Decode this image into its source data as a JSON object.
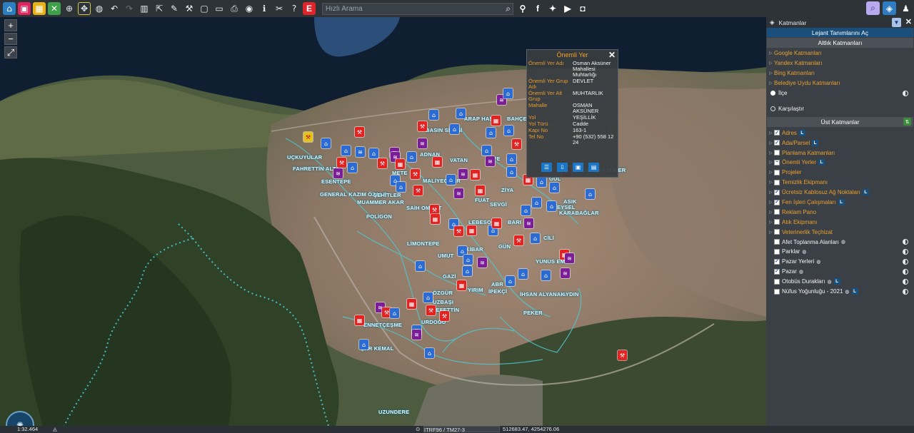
{
  "toolbar": {
    "search_placeholder": "Hızlı Arama",
    "icons": [
      "home-icon",
      "save-icon",
      "grid-icon",
      "expand-icon",
      "zoom-in-icon",
      "move-icon",
      "globe-icon",
      "undo-icon",
      "redo-icon",
      "trash-icon",
      "share-icon",
      "pencil-icon",
      "tools-icon",
      "frame-icon",
      "comment-icon",
      "print-icon",
      "info-pin-icon",
      "info-icon",
      "measure-icon",
      "help-icon",
      "e-logo-icon"
    ]
  },
  "map": {
    "zoom_in": "+",
    "zoom_out": "−",
    "fullscreen": "⤢",
    "labels": [
      "UÇKUYULAR",
      "FAHRETTİN ALTAY",
      "ESENTEPE",
      "GENERAL KAZIM ÖZALP",
      "MUAMMER AKAR",
      "POLİGON",
      "ŞEHİTLER",
      "MALİYECİLER",
      "SAİH OMURT",
      "BASIN SİTESİ",
      "ARAP HASAN",
      "BAHÇE",
      "ADNAN",
      "VATAN",
      "OSMAN AKSÜNER",
      "KARABAĞLAR",
      "ASIK",
      "EYSEL",
      "ZİYA",
      "SEVGİ",
      "REFE",
      "LİMONTEPE",
      "KİBAR",
      "UMUT",
      "GAZİ",
      "ÖZGÜR",
      "YUNUS EMRE",
      "AYDIN",
      "İHSAN ALYANAK",
      "PEKER",
      "UZBAŞI",
      "REFETTİN",
      "URDOĞU",
      "ENNETÇEŞME",
      "ŞAR KEMAL",
      "UZUNDERE",
      "İPEKÇİ",
      "ABR",
      "YIRIM",
      "METE",
      "BARI",
      "FUAT",
      "LEBESO",
      "GÜN",
      "CİLİ",
      "GÜL"
    ]
  },
  "popup": {
    "title": "Önemli Yer",
    "rows": [
      {
        "key": "Önemli Yer Adı",
        "value": "Osman Aksüner Mahallesi Muhtarlığı"
      },
      {
        "key": "Önemli Yer Grup Adı",
        "value": "DEVLET"
      },
      {
        "key": "Önemli Yer Alt Grup",
        "value": "MUHTARLIK"
      },
      {
        "key": "Mahalle",
        "value": "OSMAN AKSÜNER"
      },
      {
        "key": "Yol",
        "value": "YEŞİLLİK"
      },
      {
        "key": "Yol Türü",
        "value": "Cadde"
      },
      {
        "key": "Kapı No",
        "value": "163-1"
      },
      {
        "key": "Tel No",
        "value": "+90 (532) 558 12 24"
      }
    ]
  },
  "panel": {
    "title": "Katmanlar",
    "legend_button": "Lejant Tanımlarını Aç",
    "base_title": "Altlık Katmanları",
    "base_layers": [
      "Google Katmanları",
      "Yandex Katmanları",
      "Bing Katmanları",
      "Belediye Uydu Katmanları"
    ],
    "radio_ilce": "İlçe",
    "radio_karsilastir": "Karşılaştır",
    "top_title": "Üst Katmanlar",
    "top_layers": [
      {
        "label": "Adres",
        "checked": true,
        "color": "orange",
        "L": true
      },
      {
        "label": "Ada/Parsel",
        "checked": true,
        "color": "orange",
        "L": true
      },
      {
        "label": "Planlama Katmanları",
        "checked": false,
        "color": "orange"
      },
      {
        "label": "Önemli Yerler",
        "checked": true,
        "color": "orange",
        "L": true,
        "partial": true
      },
      {
        "label": "Projeler",
        "checked": false,
        "color": "orange"
      },
      {
        "label": "Temizlik Ekipmanı",
        "checked": false,
        "color": "orange"
      },
      {
        "label": "Ücretsiz Kablosuz Ağ Noktaları",
        "checked": true,
        "color": "orange",
        "L": true
      },
      {
        "label": "Fen İşleri Çalışmaları",
        "checked": true,
        "color": "orange",
        "L": true
      },
      {
        "label": "Reklam Pano",
        "checked": false,
        "color": "orange"
      },
      {
        "label": "Atık Ekipmanı",
        "checked": false,
        "color": "orange"
      },
      {
        "label": "Veterinerlik Teçhizat",
        "checked": false,
        "color": "orange"
      },
      {
        "label": "Afet Toplanma Alanları",
        "checked": false,
        "color": "white",
        "globe": true,
        "op": true
      },
      {
        "label": "Parklar",
        "checked": false,
        "color": "white",
        "globe": true,
        "op": true
      },
      {
        "label": "Pazar Yerleri",
        "checked": true,
        "color": "white",
        "globe": true,
        "op": true
      },
      {
        "label": "Pazar",
        "checked": true,
        "color": "white",
        "globe": true,
        "op": true
      },
      {
        "label": "Otobüs Durakları",
        "checked": false,
        "color": "white",
        "globe": true,
        "L": true,
        "op": true
      },
      {
        "label": "Nüfus Yoğunluğu - 2021",
        "checked": false,
        "color": "white",
        "globe": true,
        "L": true,
        "op": true
      }
    ]
  },
  "status": {
    "scale": "1:32.464",
    "projection": "ITRF96 / TM27-3",
    "coordinates": "512683.47, 4254276.06"
  },
  "colors": {
    "accent": "#1a4f7b",
    "layer_label": "#e9a030",
    "marker_blue": "#2c6bd2",
    "marker_red": "#e32222",
    "marker_purple": "#7b1d96"
  }
}
